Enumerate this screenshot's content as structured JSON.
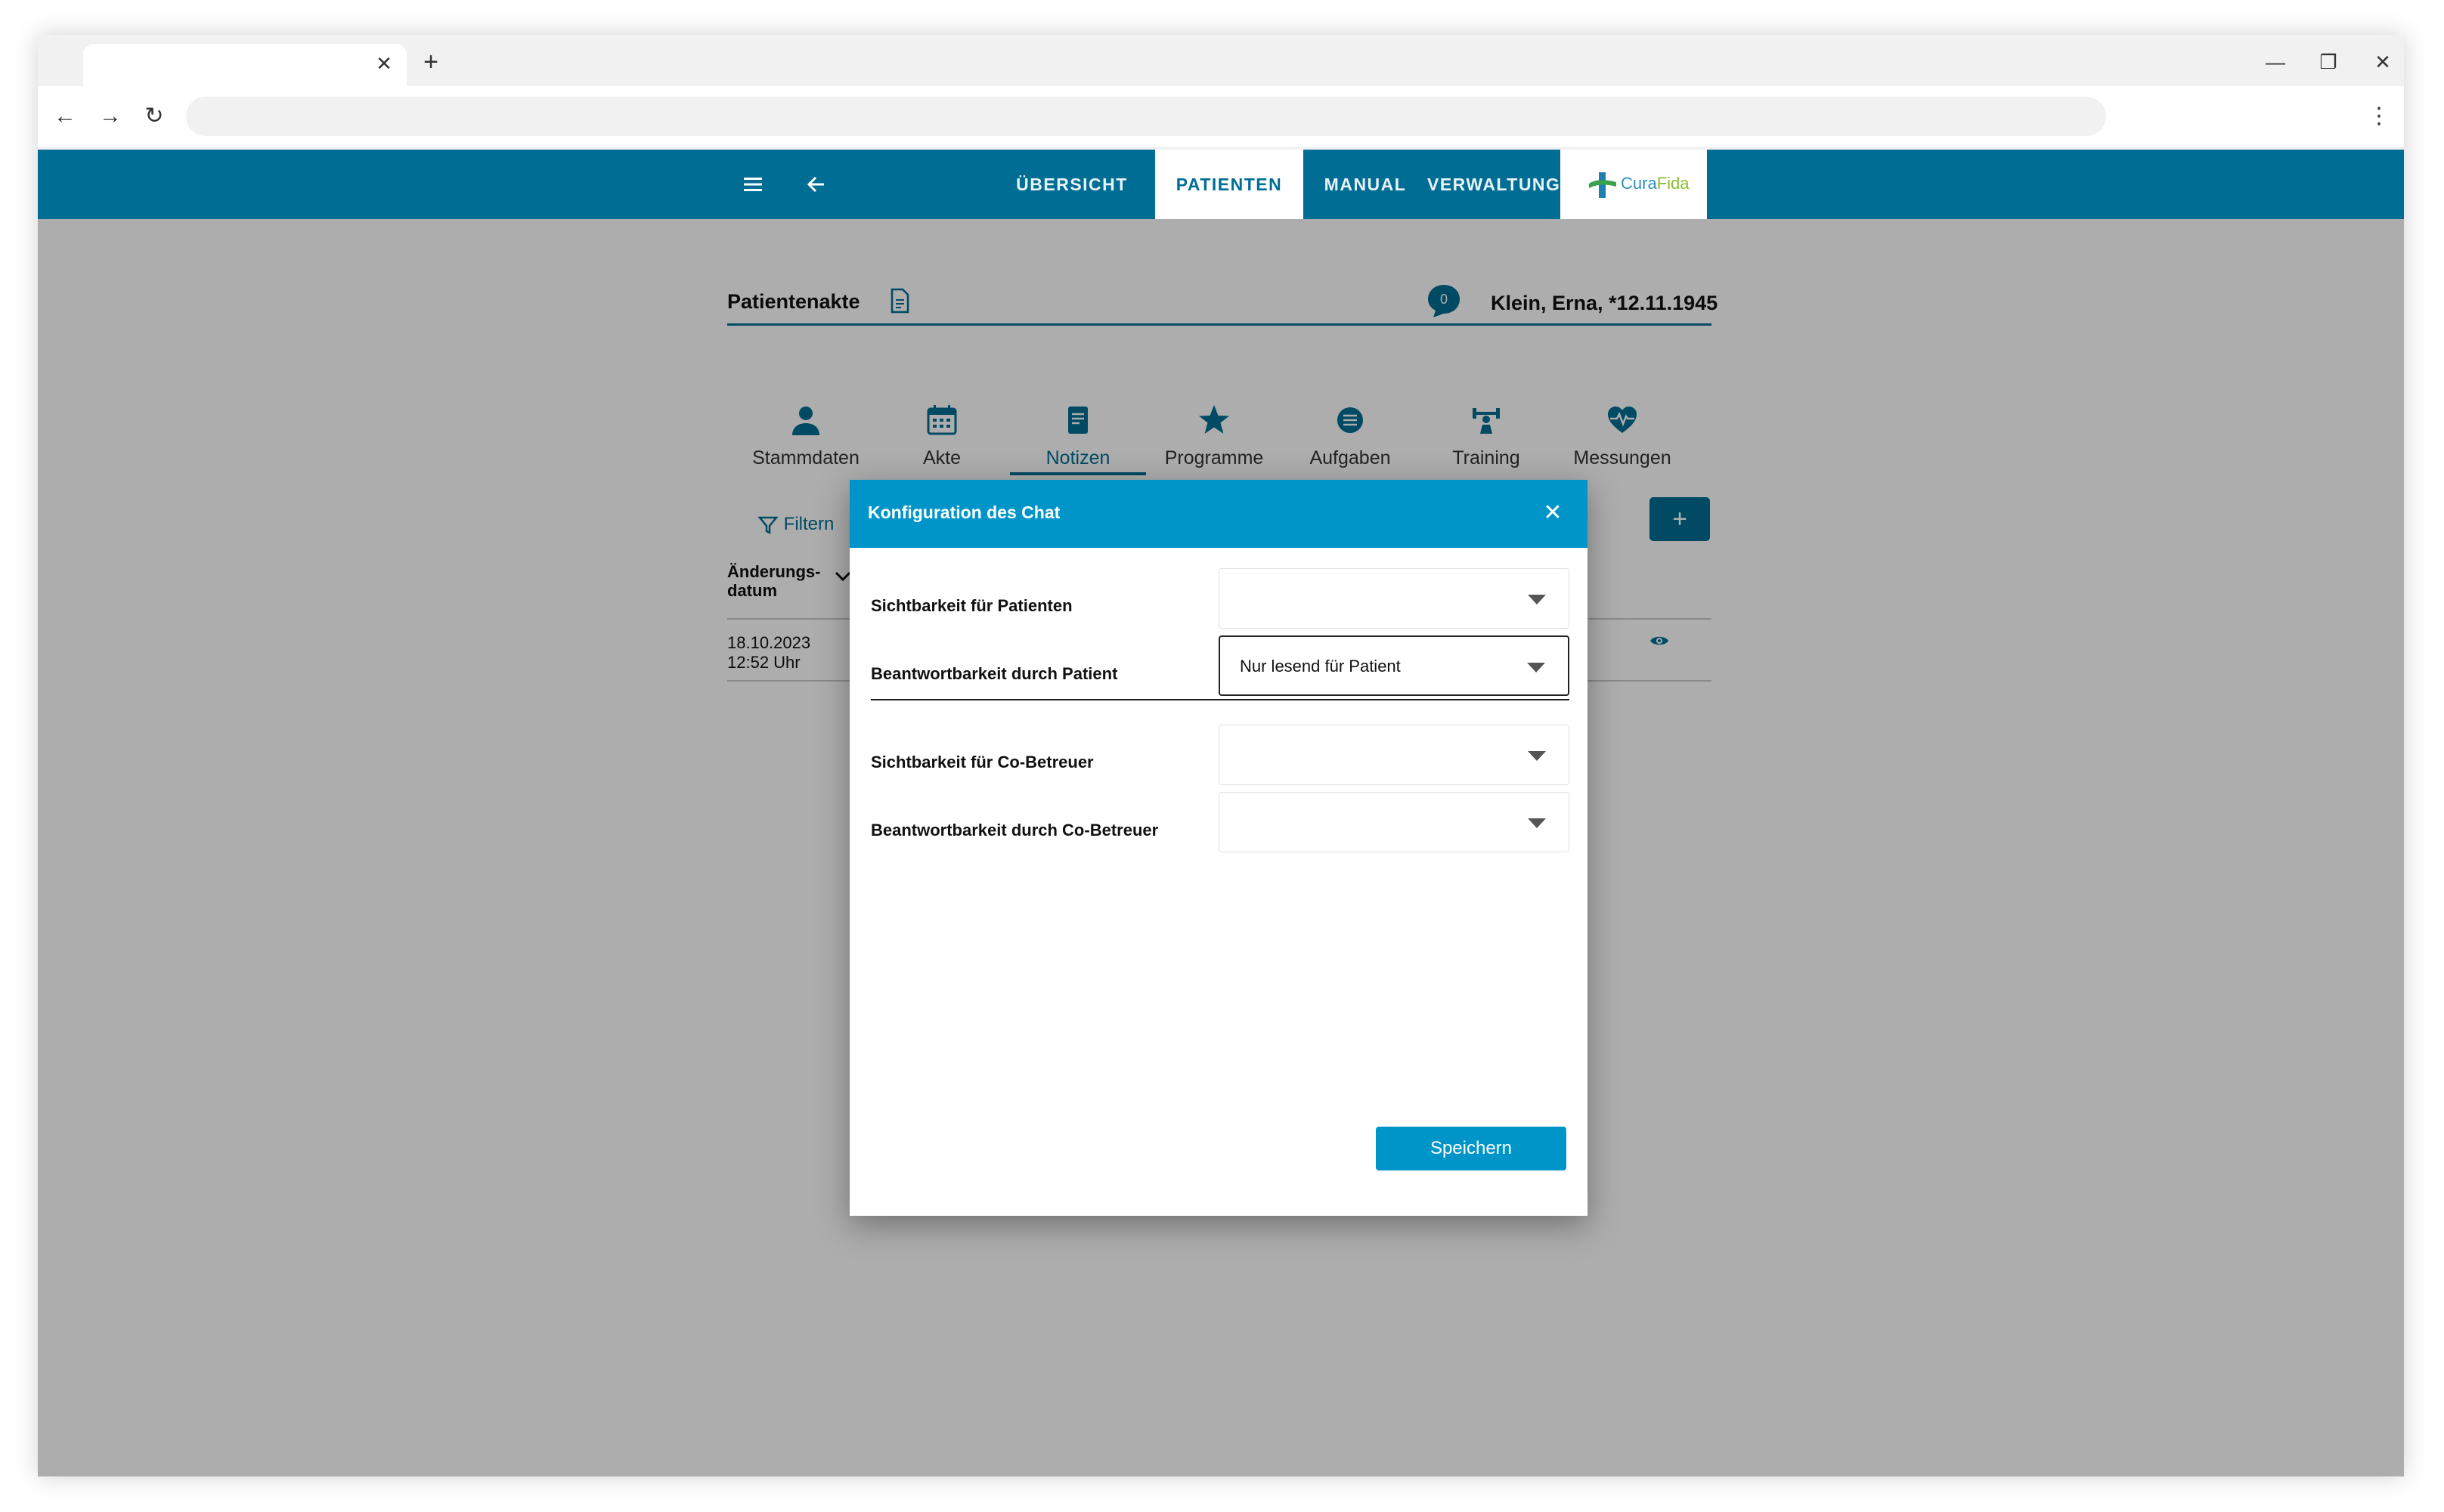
{
  "browser": {
    "tab_close": "✕",
    "new_tab": "+",
    "minimize": "—",
    "restore": "❐",
    "close": "✕",
    "back": "←",
    "forward": "→",
    "reload": "↻",
    "menu": "⋮",
    "address": ""
  },
  "appbar": {
    "nav": [
      "ÜBERSICHT",
      "PATIENTEN",
      "MANUAL",
      "VERWALTUNG"
    ],
    "active_nav": "PATIENTEN",
    "logo_part1": "Cura",
    "logo_part2": "Fida",
    "color": "#006d94"
  },
  "record": {
    "title": "Patientenakte",
    "chat_count": "0",
    "patient": "Klein, Erna, *12.11.1945"
  },
  "patient_tabs": [
    {
      "label": "Stammdaten",
      "icon": "person-icon"
    },
    {
      "label": "Akte",
      "icon": "calendar-icon"
    },
    {
      "label": "Notizen",
      "icon": "note-icon"
    },
    {
      "label": "Programme",
      "icon": "star-icon"
    },
    {
      "label": "Aufgaben",
      "icon": "list-icon"
    },
    {
      "label": "Training",
      "icon": "training-icon"
    },
    {
      "label": "Messungen",
      "icon": "heart-pulse-icon"
    }
  ],
  "active_tab": "Notizen",
  "list": {
    "filter_label": "Filtern",
    "add_label": "+",
    "column_header_line1": "Änderungs-",
    "column_header_line2": "datum",
    "rows": [
      {
        "date": "18.10.2023",
        "time": "12:52 Uhr"
      }
    ]
  },
  "dialog": {
    "title": "Konfiguration des Chat",
    "close": "✕",
    "fields": [
      {
        "label": "Sichtbarkeit für Patienten",
        "value": ""
      },
      {
        "label": "Beantwortbarkeit durch Patient",
        "value": "Nur lesend für Patient"
      },
      {
        "label": "Sichtbarkeit für Co-Betreuer",
        "value": ""
      },
      {
        "label": "Beantwortbarkeit durch Co-Betreuer",
        "value": ""
      }
    ],
    "save_label": "Speichern",
    "header_color": "#0095c9"
  }
}
